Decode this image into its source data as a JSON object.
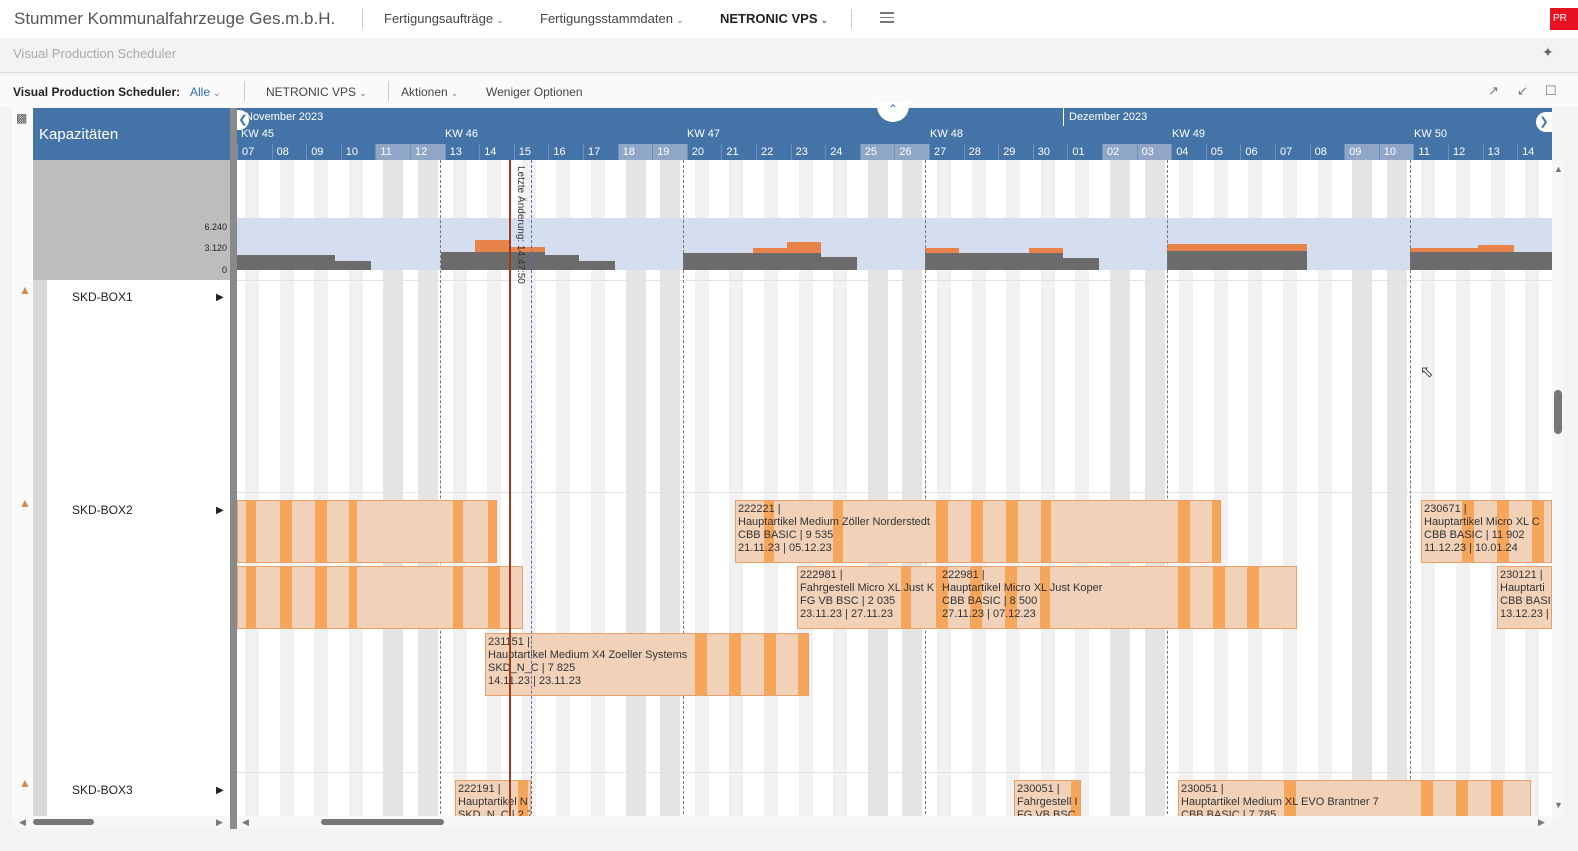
{
  "nav": {
    "company": "Stummer Kommunalfahrzeuge Ges.m.b.H.",
    "items": [
      "Fertigungsaufträge",
      "Fertigungsstammdaten",
      "NETRONIC VPS"
    ],
    "badge": "PR"
  },
  "page": {
    "title": "Visual Production Scheduler"
  },
  "toolbar": {
    "label": "Visual Production Scheduler:",
    "filter": "Alle",
    "view": "NETRONIC VPS",
    "actions": "Aktionen",
    "less": "Weniger Optionen"
  },
  "left_panel": {
    "header": "Kapazitäten",
    "y_labels": [
      "6.240",
      "3.120",
      "0"
    ],
    "resources": [
      "SKD-BOX1",
      "SKD-BOX2",
      "SKD-BOX3"
    ]
  },
  "timeline": {
    "months": [
      "November 2023",
      "Dezember 2023"
    ],
    "weeks": [
      "KW 45",
      "KW 46",
      "KW 47",
      "KW 48",
      "KW 49",
      "KW 50"
    ],
    "days": [
      "07",
      "08",
      "09",
      "10",
      "11",
      "12",
      "13",
      "14",
      "15",
      "16",
      "17",
      "18",
      "19",
      "20",
      "21",
      "22",
      "23",
      "24",
      "25",
      "26",
      "27",
      "28",
      "29",
      "30",
      "01",
      "02",
      "03",
      "04",
      "05",
      "06",
      "07",
      "08",
      "09",
      "10",
      "11",
      "12",
      "13",
      "14"
    ],
    "weekend_days": [
      "11",
      "12",
      "18",
      "19",
      "25",
      "26",
      "02",
      "03",
      "09",
      "10"
    ],
    "last_change": "Letzte Änderung: 14:47:50"
  },
  "orders": [
    {
      "lines": [
        "222221 |",
        "Hauptartikel Medium Zöller Norderstedt",
        "CBB BASIC | 9 535",
        "21.11.23 | 05.12.23"
      ]
    },
    {
      "lines": [
        "230671 |",
        "Hauptartikel Micro XL C",
        "CBB BASIC | 11 902",
        "11.12.23 | 10.01.24"
      ]
    },
    {
      "lines": [
        "222981 |",
        "Fahrgestell Micro XL Just K",
        "FG VB BSC | 2 035",
        "23.11.23 | 27.11.23"
      ]
    },
    {
      "lines": [
        "222981 |",
        "Hauptartikel Micro XL Just Koper",
        "CBB BASIC | 8 500",
        "27.11.23 | 07.12.23"
      ]
    },
    {
      "lines": [
        "230121 |",
        "Hauptarti",
        "CBB BASIC",
        "13.12.23 |"
      ]
    },
    {
      "lines": [
        "231151 |",
        "Hauptartikel Medium X4 Zoeller Systems",
        "SKD_N_C | 7 825",
        "14.11.23 | 23.11.23"
      ]
    },
    {
      "lines": [
        "222191 |",
        "Hauptartikel N",
        "SKD_N_C | 2 78"
      ]
    },
    {
      "lines": [
        "230051 |",
        "Fahrgestell I",
        "FG VB BSC"
      ]
    },
    {
      "lines": [
        "230051 |",
        "Hauptartikel Medium XL EVO Brantner 7",
        "CBB BASIC | 7 785"
      ]
    }
  ],
  "colors": {
    "header_blue": "#4473a8",
    "bar_fill": "#f1d2b8",
    "bar_accent": "#f6a65a",
    "load_orange": "#e8834a",
    "load_gray": "#6b6b6b"
  },
  "icons": [
    "pin-icon",
    "share-icon",
    "collapse-icon",
    "bookmark-icon",
    "menu-icon",
    "resource-icon"
  ]
}
